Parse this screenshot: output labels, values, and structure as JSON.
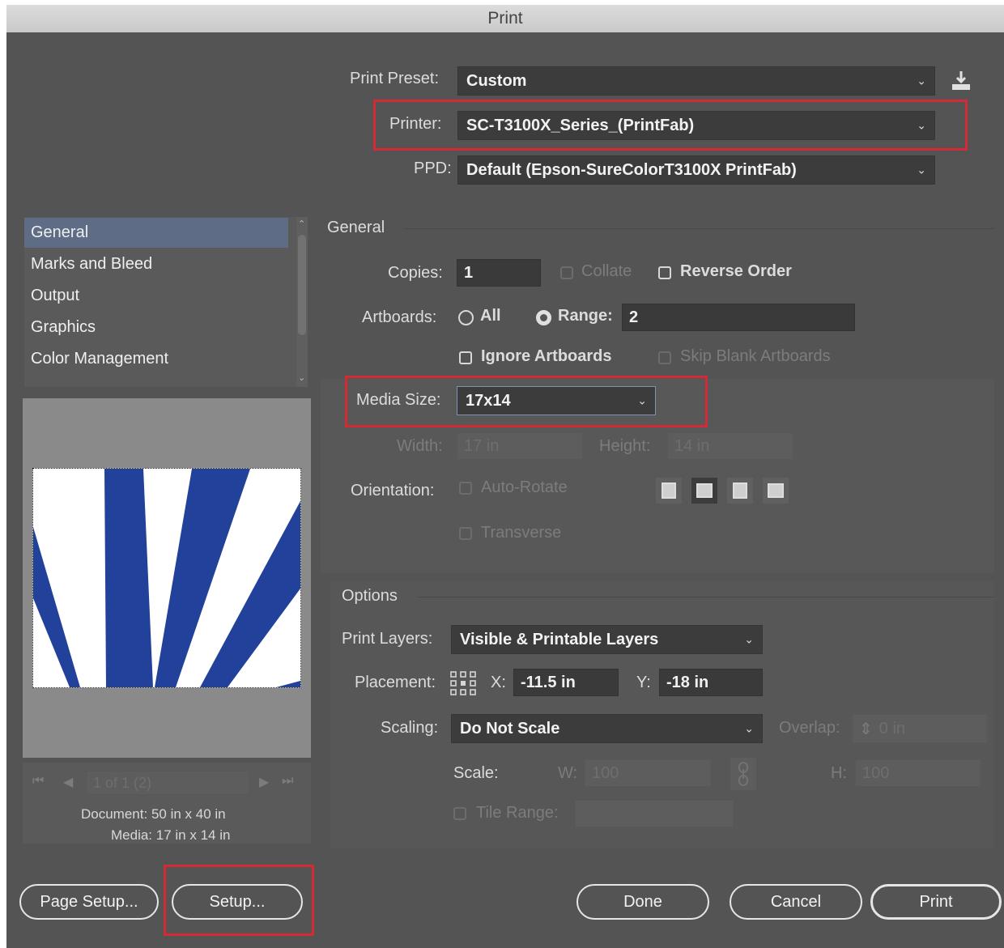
{
  "window": {
    "title": "Print"
  },
  "top": {
    "print_preset_label": "Print Preset:",
    "print_preset_value": "Custom",
    "printer_label": "Printer:",
    "printer_value": "SC-T3100X_Series_(PrintFab)",
    "ppd_label": "PPD:",
    "ppd_value": "Default (Epson-SureColorT3100X PrintFab)"
  },
  "sidebar": {
    "items": [
      {
        "label": "General"
      },
      {
        "label": "Marks and Bleed"
      },
      {
        "label": "Output"
      },
      {
        "label": "Graphics"
      },
      {
        "label": "Color Management"
      }
    ],
    "active_index": 0
  },
  "preview": {
    "page_indicator": "1 of 1 (2)",
    "document_label": "Document:",
    "document_value": "50 in x 40 in",
    "media_label": "Media:",
    "media_value": "17 in x 14 in",
    "colors": {
      "blue": "#21419a",
      "white": "#ffffff"
    }
  },
  "general": {
    "section_title": "General",
    "copies_label": "Copies:",
    "copies_value": "1",
    "collate_label": "Collate",
    "reverse_order_label": "Reverse Order",
    "artboards_label": "Artboards:",
    "all_label": "All",
    "range_label": "Range:",
    "range_value": "2",
    "ignore_artboards_label": "Ignore Artboards",
    "skip_blank_label": "Skip Blank Artboards",
    "media_size_label": "Media Size:",
    "media_size_value": "17x14",
    "width_label": "Width:",
    "width_value": "17 in",
    "height_label": "Height:",
    "height_value": "14 in",
    "orientation_label": "Orientation:",
    "auto_rotate_label": "Auto-Rotate",
    "transverse_label": "Transverse"
  },
  "options": {
    "section_title": "Options",
    "print_layers_label": "Print Layers:",
    "print_layers_value": "Visible & Printable Layers",
    "placement_label": "Placement:",
    "x_label": "X:",
    "x_value": "-11.5 in",
    "y_label": "Y:",
    "y_value": "-18 in",
    "scaling_label": "Scaling:",
    "scaling_value": "Do Not Scale",
    "overlap_label": "Overlap:",
    "overlap_value": "0 in",
    "scale_label": "Scale:",
    "w_label": "W:",
    "w_value": "100",
    "h_label": "H:",
    "h_value": "100",
    "tile_range_label": "Tile Range:"
  },
  "buttons": {
    "page_setup": "Page Setup...",
    "setup": "Setup...",
    "done": "Done",
    "cancel": "Cancel",
    "print": "Print"
  },
  "highlight_color": "#d42a35"
}
